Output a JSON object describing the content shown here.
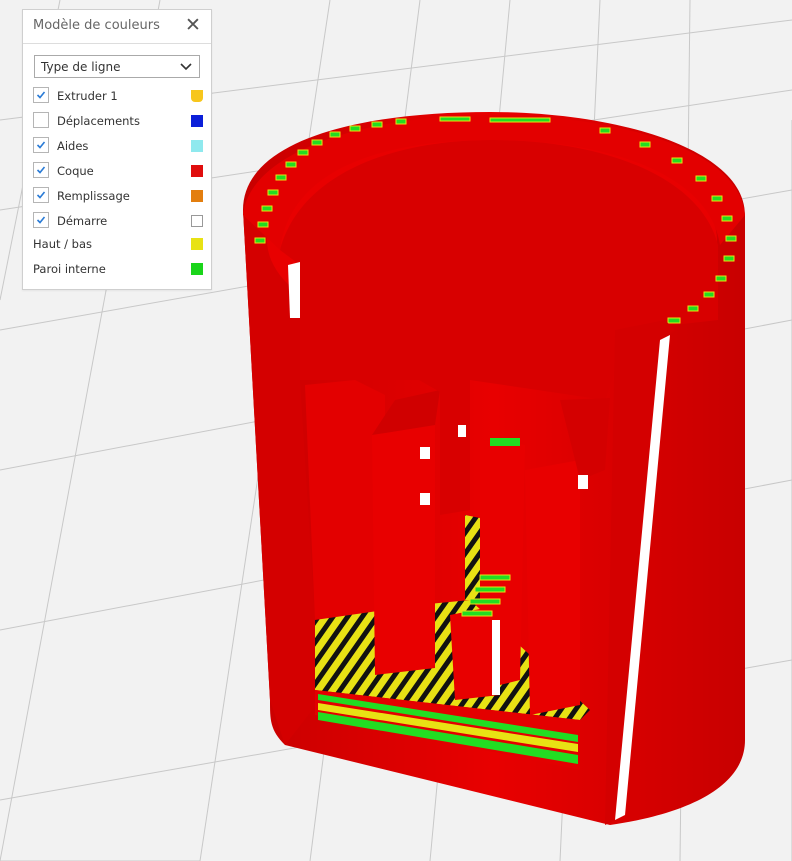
{
  "panel": {
    "title": "Modèle de couleurs",
    "close_icon": "close-icon",
    "dropdown": {
      "selected": "Type de ligne"
    },
    "items": [
      {
        "label": "Extruder 1",
        "checked": true,
        "color": "#f7c61c"
      },
      {
        "label": "Déplacements",
        "checked": false,
        "color": "#0b1fd9"
      },
      {
        "label": "Aides",
        "checked": true,
        "color": "#8fe9ee"
      },
      {
        "label": "Coque",
        "checked": true,
        "color": "#e00d0d"
      },
      {
        "label": "Remplissage",
        "checked": true,
        "color": "#e37e0f"
      },
      {
        "label": "Démarre",
        "checked": true,
        "color": "#ffffff"
      }
    ],
    "legend": [
      {
        "label": "Haut / bas",
        "color": "#e8e214"
      },
      {
        "label": "Paroi interne",
        "color": "#1ad51a"
      }
    ]
  },
  "colors": {
    "shell": "#e30000",
    "top_bottom": "#e8e214",
    "inner_wall": "#22dd22",
    "grid": "#c8c8c8",
    "background": "#f2f2f2"
  }
}
